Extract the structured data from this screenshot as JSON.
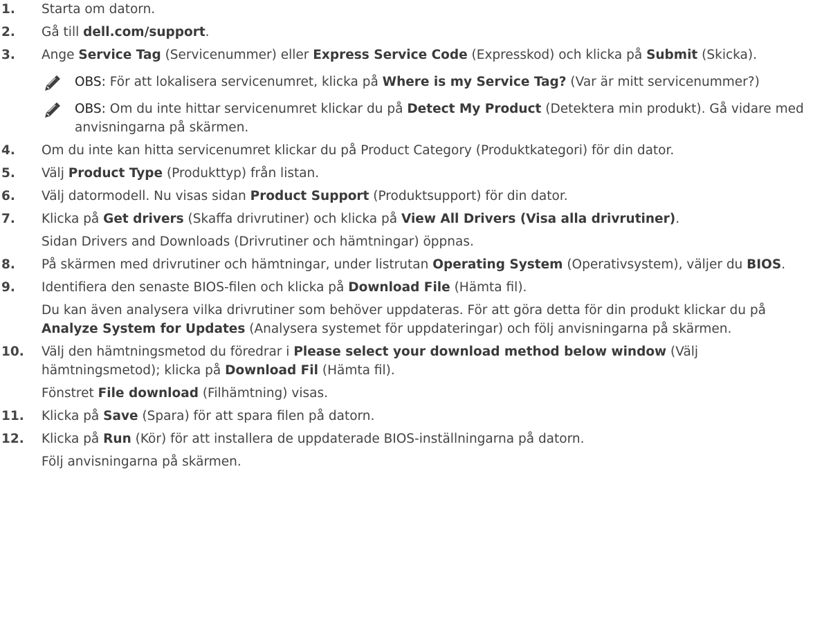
{
  "steps": [
    {
      "num": "1.",
      "paras": [
        [
          {
            "t": "Starta om datorn.",
            "b": false
          }
        ]
      ]
    },
    {
      "num": "2.",
      "paras": [
        [
          {
            "t": "Gå till ",
            "b": false
          },
          {
            "t": "dell.com/support",
            "b": true
          },
          {
            "t": ".",
            "b": false
          }
        ]
      ]
    },
    {
      "num": "3.",
      "paras": [
        [
          {
            "t": "Ange ",
            "b": false
          },
          {
            "t": "Service Tag",
            "b": true
          },
          {
            "t": " (Servicenummer) eller ",
            "b": false
          },
          {
            "t": "Express Service Code",
            "b": true
          },
          {
            "t": " (Expresskod) och klicka på ",
            "b": false
          },
          {
            "t": "Submit",
            "b": true
          },
          {
            "t": " (Skicka).",
            "b": false
          }
        ]
      ],
      "notes": [
        {
          "label": "OBS:",
          "icon": "note-pencil-icon",
          "segs": [
            {
              "t": " För att lokalisera servicenumret, klicka på ",
              "b": false
            },
            {
              "t": "Where is my Service Tag?",
              "b": true
            },
            {
              "t": " (Var är mitt servicenummer?)",
              "b": false
            }
          ]
        },
        {
          "label": "OBS:",
          "icon": "note-pencil-icon",
          "segs": [
            {
              "t": " Om du inte hittar servicenumret klickar du på ",
              "b": false
            },
            {
              "t": "Detect My Product",
              "b": true
            },
            {
              "t": " (Detektera min produkt). Gå vidare med anvisningarna på skärmen.",
              "b": false
            }
          ]
        }
      ]
    },
    {
      "num": "4.",
      "paras": [
        [
          {
            "t": "Om du inte kan hitta servicenumret klickar du på Product Category (Produktkategori) för din dator.",
            "b": false
          }
        ]
      ]
    },
    {
      "num": "5.",
      "paras": [
        [
          {
            "t": "Välj ",
            "b": false
          },
          {
            "t": "Product Type",
            "b": true
          },
          {
            "t": " (Produkttyp) från listan.",
            "b": false
          }
        ]
      ]
    },
    {
      "num": "6.",
      "paras": [
        [
          {
            "t": "Välj datormodell. Nu visas sidan ",
            "b": false
          },
          {
            "t": "Product Support",
            "b": true
          },
          {
            "t": " (Produktsupport) för din dator.",
            "b": false
          }
        ]
      ]
    },
    {
      "num": "7.",
      "paras": [
        [
          {
            "t": "Klicka på ",
            "b": false
          },
          {
            "t": "Get drivers",
            "b": true
          },
          {
            "t": " (Skaffa drivrutiner) och klicka på ",
            "b": false
          },
          {
            "t": "View All Drivers (Visa alla drivrutiner)",
            "b": true
          },
          {
            "t": ".",
            "b": false
          }
        ],
        [
          {
            "t": "Sidan Drivers and Downloads (Drivrutiner och hämtningar) öppnas.",
            "b": false
          }
        ]
      ]
    },
    {
      "num": "8.",
      "paras": [
        [
          {
            "t": "På skärmen med drivrutiner och hämtningar, under listrutan ",
            "b": false
          },
          {
            "t": "Operating System",
            "b": true
          },
          {
            "t": " (Operativsystem), väljer du ",
            "b": false
          },
          {
            "t": "BIOS",
            "b": true
          },
          {
            "t": ".",
            "b": false
          }
        ]
      ]
    },
    {
      "num": "9.",
      "paras": [
        [
          {
            "t": "Identifiera den senaste BIOS-filen och klicka på ",
            "b": false
          },
          {
            "t": "Download File",
            "b": true
          },
          {
            "t": " (Hämta fil).",
            "b": false
          }
        ],
        [
          {
            "t": "Du kan även analysera vilka drivrutiner som behöver uppdateras. För att göra detta för din produkt klickar du på ",
            "b": false
          },
          {
            "t": "Analyze System for Updates",
            "b": true
          },
          {
            "t": " (Analysera systemet för uppdateringar) och följ anvisningarna på skärmen.",
            "b": false
          }
        ]
      ]
    },
    {
      "num": "10.",
      "paras": [
        [
          {
            "t": "Välj den hämtningsmetod du föredrar i ",
            "b": false
          },
          {
            "t": "Please select your download method below window",
            "b": true
          },
          {
            "t": " (Välj hämtningsmetod); klicka på ",
            "b": false
          },
          {
            "t": "Download Fil",
            "b": true
          },
          {
            "t": " (Hämta fil).",
            "b": false
          }
        ],
        [
          {
            "t": "Fönstret ",
            "b": false
          },
          {
            "t": "File download",
            "b": true
          },
          {
            "t": " (Filhämtning) visas.",
            "b": false
          }
        ]
      ]
    },
    {
      "num": "11.",
      "paras": [
        [
          {
            "t": "Klicka på ",
            "b": false
          },
          {
            "t": "Save",
            "b": true
          },
          {
            "t": " (Spara) för att spara filen på datorn.",
            "b": false
          }
        ]
      ]
    },
    {
      "num": "12.",
      "paras": [
        [
          {
            "t": "Klicka på ",
            "b": false
          },
          {
            "t": "Run",
            "b": true
          },
          {
            "t": " (Kör) för att installera de uppdaterade BIOS-inställningarna på datorn.",
            "b": false
          }
        ],
        [
          {
            "t": "Följ anvisningarna på skärmen.",
            "b": false
          }
        ]
      ]
    }
  ]
}
